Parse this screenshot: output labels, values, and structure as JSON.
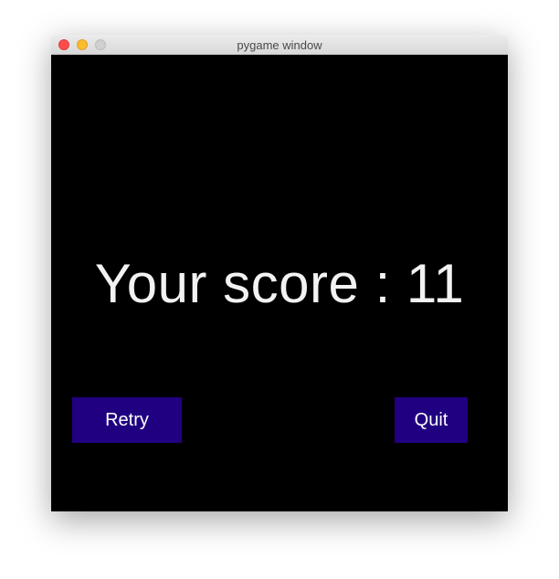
{
  "window": {
    "title": "pygame window"
  },
  "game": {
    "score_text": "Your score : 11",
    "buttons": {
      "retry": "Retry",
      "quit": "Quit"
    },
    "colors": {
      "background": "#000000",
      "button": "#200080",
      "text": "#ffffff"
    }
  }
}
